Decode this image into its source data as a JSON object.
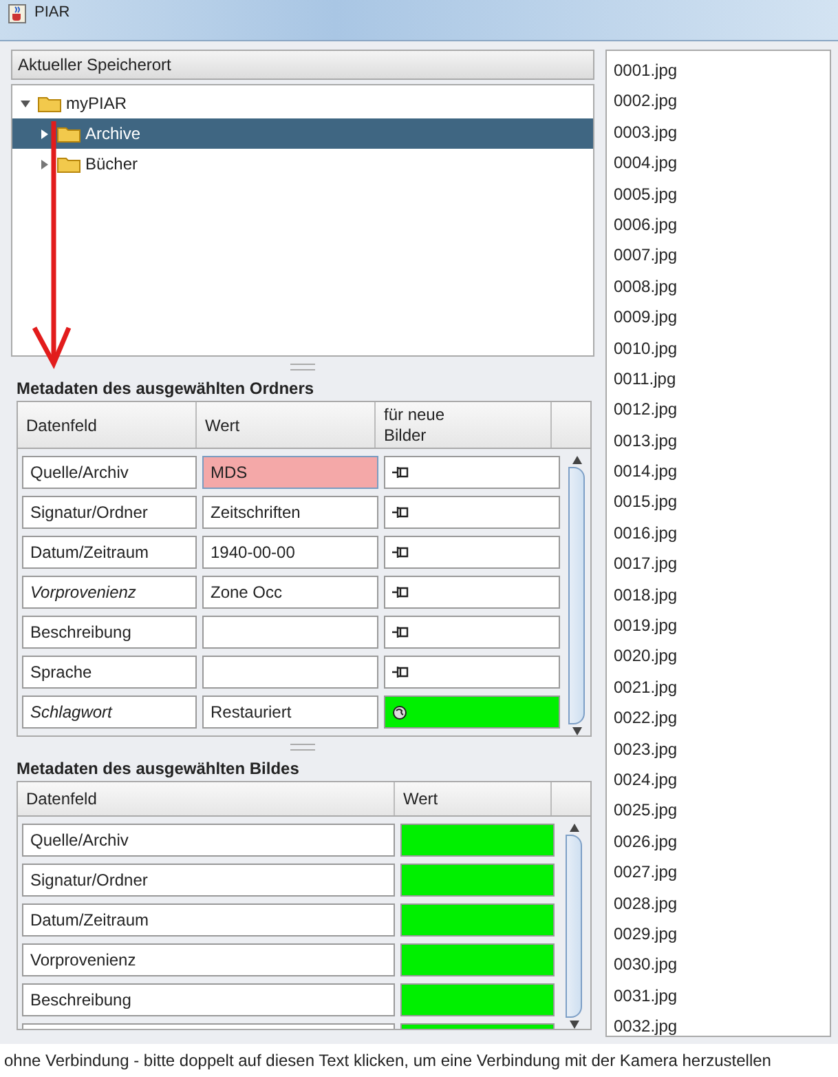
{
  "window": {
    "title": "PIAR"
  },
  "location": {
    "header": "Aktueller Speicherort",
    "tree": [
      {
        "label": "myPIAR",
        "expanded": true,
        "selected": false,
        "children": [
          {
            "label": "Archive",
            "expanded": false,
            "selected": true
          },
          {
            "label": "Bücher",
            "expanded": false,
            "selected": false
          }
        ]
      }
    ]
  },
  "folder_metadata": {
    "title": "Metadaten des ausgewählten Ordners",
    "columns": [
      "Datenfeld",
      "Wert",
      "für neue Bilder"
    ],
    "rows": [
      {
        "field": "Quelle/Archiv",
        "italic": false,
        "value": "MDS",
        "invalid": true,
        "kind": "pin",
        "active": false
      },
      {
        "field": "Signatur/Ordner",
        "italic": false,
        "value": "Zeitschriften",
        "invalid": false,
        "kind": "pin",
        "active": false
      },
      {
        "field": "Datum/Zeitraum",
        "italic": false,
        "value": "1940-00-00",
        "invalid": false,
        "kind": "pin",
        "active": false
      },
      {
        "field": "Vorprovenienz",
        "italic": true,
        "value": "Zone Occ",
        "invalid": false,
        "kind": "pin",
        "active": false
      },
      {
        "field": "Beschreibung",
        "italic": false,
        "invalid": false,
        "kind": "pin",
        "active": false
      },
      {
        "field": "Sprache",
        "italic": false,
        "invalid": false,
        "kind": "pin",
        "active": false
      },
      {
        "field": "Schlagwort",
        "italic": true,
        "value": "Restauriert",
        "invalid": false,
        "kind": "globe",
        "active": true
      }
    ]
  },
  "image_metadata": {
    "title": "Metadaten des ausgewählten Bildes",
    "columns": [
      "Datenfeld",
      "Wert"
    ],
    "rows": [
      {
        "field": "Quelle/Archiv",
        "filled": true
      },
      {
        "field": "Signatur/Ordner",
        "filled": true
      },
      {
        "field": "Datum/Zeitraum",
        "filled": true
      },
      {
        "field": "Vorprovenienz",
        "filled": true
      },
      {
        "field": "Beschreibung",
        "filled": true
      }
    ]
  },
  "files": [
    "0001.jpg",
    "0002.jpg",
    "0003.jpg",
    "0004.jpg",
    "0005.jpg",
    "0006.jpg",
    "0007.jpg",
    "0008.jpg",
    "0009.jpg",
    "0010.jpg",
    "0011.jpg",
    "0012.jpg",
    "0013.jpg",
    "0014.jpg",
    "0015.jpg",
    "0016.jpg",
    "0017.jpg",
    "0018.jpg",
    "0019.jpg",
    "0020.jpg",
    "0021.jpg",
    "0022.jpg",
    "0023.jpg",
    "0024.jpg",
    "0025.jpg",
    "0026.jpg",
    "0027.jpg",
    "0028.jpg",
    "0029.jpg",
    "0030.jpg",
    "0031.jpg",
    "0032.jpg"
  ],
  "status_bar": "ohne Verbindung - bitte doppelt auf diesen Text klicken, um eine Verbindung mit der Kamera herzustellen"
}
